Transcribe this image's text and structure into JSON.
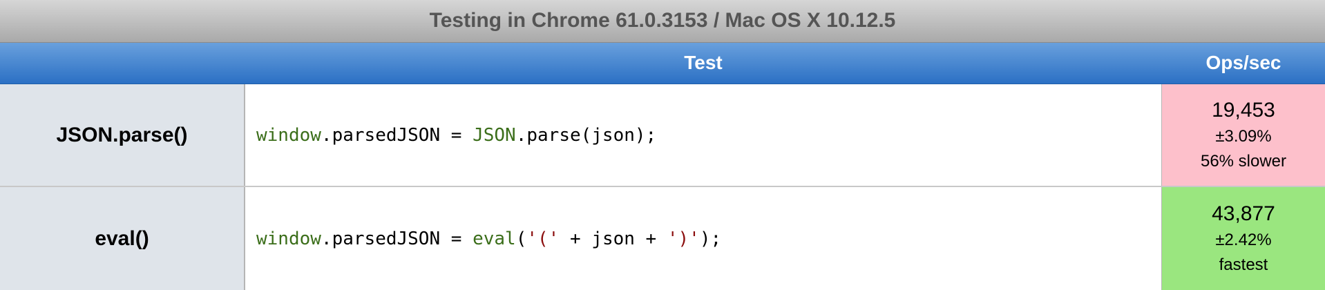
{
  "caption": "Testing in Chrome 61.0.3153 / Mac OS X 10.12.5",
  "header": {
    "test_label": "Test",
    "ops_label": "Ops/sec"
  },
  "rows": [
    {
      "name": "JSON.parse()",
      "code": {
        "t1": "window",
        "t2": ".parsedJSON = ",
        "t3": "JSON",
        "t4": ".parse(json);"
      },
      "ops": "19,453",
      "error": "±3.09%",
      "status": "56% slower",
      "status_color": "#fdc0cb"
    },
    {
      "name": "eval()",
      "code": {
        "t1": "window",
        "t2": ".parsedJSON = ",
        "t3": "eval",
        "t4": "(",
        "t5": "'('",
        "t6": " + json + ",
        "t7": "')'",
        "t8": ");"
      },
      "ops": "43,877",
      "error": "±2.42%",
      "status": "fastest",
      "status_color": "#9ae67f"
    }
  ]
}
